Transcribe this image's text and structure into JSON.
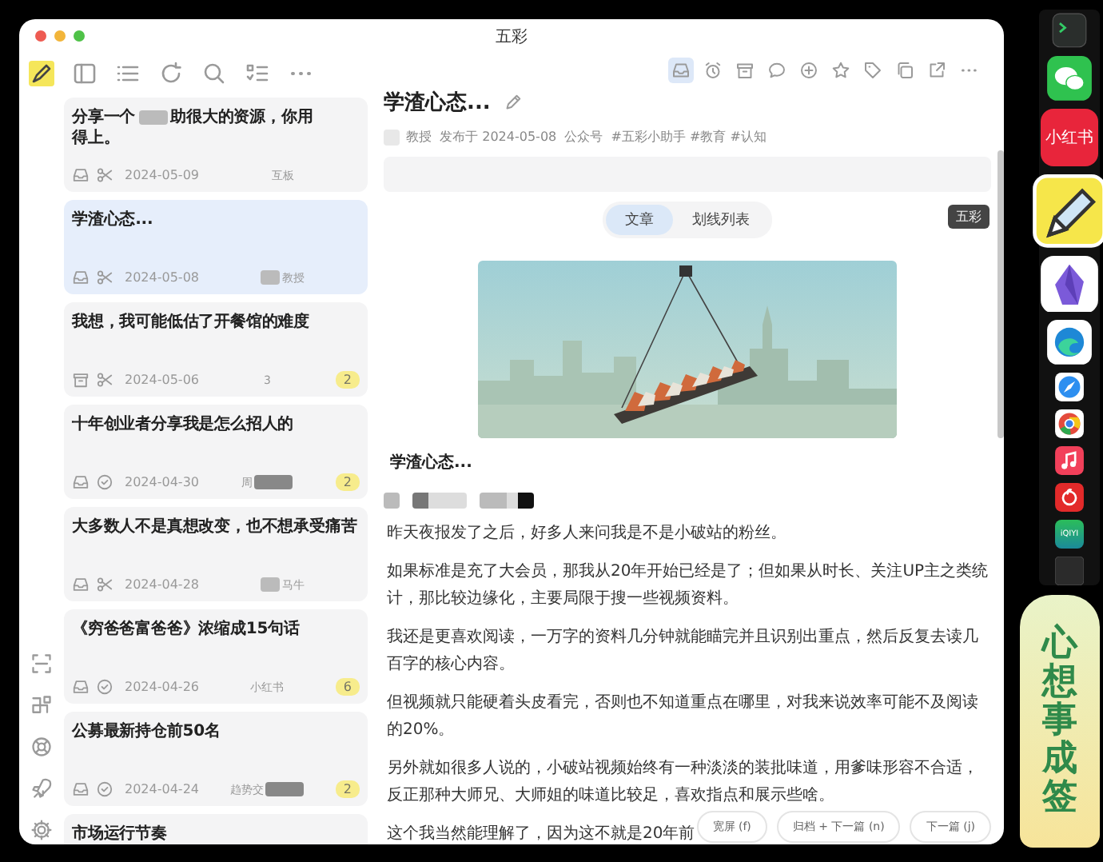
{
  "window": {
    "title": "五彩"
  },
  "left_toolbar": [
    {
      "kind": "logo"
    },
    {
      "kind": "sidebar"
    },
    {
      "kind": "list"
    },
    {
      "kind": "refresh"
    },
    {
      "kind": "search"
    },
    {
      "kind": "checklist"
    },
    {
      "kind": "more"
    }
  ],
  "cards": [
    {
      "title_parts": [
        {
          "kind": "text",
          "text": "分享一个"
        },
        {
          "kind": "redaction"
        },
        {
          "kind": "text",
          "text": "助很大的资源，你用"
        },
        {
          "kind": "text",
          "text": "得上。"
        }
      ],
      "icons": [
        {
          "kind": "inbox"
        },
        {
          "kind": "scissors"
        }
      ],
      "date": "2024-05-09",
      "source_parts": [
        {
          "kind": "text",
          "text": "互板"
        }
      ],
      "selected": false
    },
    {
      "title_parts": [
        {
          "kind": "text",
          "text": "学渣心态..."
        }
      ],
      "icons": [
        {
          "kind": "inbox"
        },
        {
          "kind": "scissors"
        }
      ],
      "date": "2024-05-08",
      "source_parts": [
        {
          "kind": "redaction"
        },
        {
          "kind": "text",
          "text": "教授"
        }
      ],
      "selected": true
    },
    {
      "title_parts": [
        {
          "kind": "text",
          "text": "我想，我可能低估了开餐馆的难度"
        }
      ],
      "icons": [
        {
          "kind": "archive"
        },
        {
          "kind": "scissors"
        }
      ],
      "date": "2024-05-06",
      "source_parts": [
        {
          "kind": "text",
          "text": "3"
        }
      ],
      "badge": "2",
      "selected": false
    },
    {
      "title_parts": [
        {
          "kind": "text",
          "text": "十年创业者分享我是怎么招人的"
        }
      ],
      "icons": [
        {
          "kind": "inbox"
        },
        {
          "kind": "circle"
        }
      ],
      "date": "2024-04-30",
      "source_parts": [
        {
          "kind": "text",
          "text": "周"
        },
        {
          "kind": "redaction"
        }
      ],
      "badge": "2",
      "selected": false
    },
    {
      "title_parts": [
        {
          "kind": "text",
          "text": "大多数人不是真想改变，也不想承受痛苦"
        }
      ],
      "icons": [
        {
          "kind": "inbox"
        },
        {
          "kind": "scissors"
        }
      ],
      "date": "2024-04-28",
      "source_parts": [
        {
          "kind": "redaction"
        },
        {
          "kind": "text",
          "text": "马牛"
        }
      ],
      "selected": false
    },
    {
      "title_parts": [
        {
          "kind": "text",
          "text": "《穷爸爸富爸爸》浓缩成15句话"
        }
      ],
      "icons": [
        {
          "kind": "inbox"
        },
        {
          "kind": "circle"
        }
      ],
      "date": "2024-04-26",
      "source_parts": [
        {
          "kind": "text",
          "text": "小红书"
        }
      ],
      "badge": "6",
      "selected": false
    },
    {
      "title_parts": [
        {
          "kind": "text",
          "text": "公募最新持仓前50名"
        }
      ],
      "icons": [
        {
          "kind": "inbox"
        },
        {
          "kind": "circle"
        }
      ],
      "date": "2024-04-24",
      "source_parts": [
        {
          "kind": "text",
          "text": "趋势交"
        },
        {
          "kind": "redaction"
        }
      ],
      "badge": "2",
      "selected": false
    },
    {
      "title_parts": [
        {
          "kind": "text",
          "text": "市场运行节奏"
        }
      ],
      "selected": false
    }
  ],
  "rail": [
    {
      "kind": "scan"
    },
    {
      "kind": "apps"
    },
    {
      "kind": "lifebuoy"
    },
    {
      "kind": "rocket"
    },
    {
      "kind": "gear"
    }
  ],
  "content_toolbar": [
    {
      "kind": "inbox",
      "selected": true
    },
    {
      "kind": "alarm",
      "selected": false
    },
    {
      "kind": "archive",
      "selected": false
    },
    {
      "kind": "comment",
      "selected": false
    },
    {
      "kind": "plus",
      "selected": false
    },
    {
      "kind": "star",
      "selected": false
    },
    {
      "kind": "tag",
      "selected": false
    },
    {
      "kind": "copy",
      "selected": false
    },
    {
      "kind": "external",
      "selected": false
    },
    {
      "kind": "more",
      "selected": false
    }
  ],
  "article": {
    "title": "学渣心态...",
    "meta": "教授  发布于 2024-05-08  公众号  #五彩小助手 #教育 #认知",
    "tabs": [
      {
        "label": "文章",
        "selected": true
      },
      {
        "label": "划线列表",
        "selected": false
      }
    ],
    "heading": "学渣心态...",
    "paragraphs": [
      "昨天夜报发了之后，好多人来问我是不是小破站的粉丝。",
      "如果标准是充了大会员，那我从20年开始已经是了；但如果从时长、关注UP主之类统计，那比较边缘化，主要局限于搜一些视频资料。",
      "我还是更喜欢阅读，一万字的资料几分钟就能瞄完并且识别出重点，然后反复去读几百字的核心内容。",
      "但视频就只能硬着头皮看完，否则也不知道重点在哪里，对我来说效率可能不及阅读的20%。",
      "另外就如很多人说的，小破站视频始终有一种淡淡的装批味道，用爹味形容不合适，反正那种大师兄、大师姐的味道比较足，喜欢指点和展示些啥。",
      "这个我当然能理解了，因为这不就是20年前"
    ],
    "buttons": [
      "宽屏 (f)",
      "归档 + 下一篇 (n)",
      "下一篇 (j)"
    ]
  },
  "dock_tooltip": "五彩",
  "dock": [
    {
      "kind": "terminal"
    },
    {
      "kind": "chat"
    },
    {
      "kind": "redbook",
      "label": "小红书"
    },
    {
      "kind": "pen"
    },
    {
      "kind": "gem"
    },
    {
      "kind": "wave"
    },
    {
      "kind": "compass"
    },
    {
      "kind": "chrome"
    },
    {
      "kind": "music"
    },
    {
      "kind": "netease"
    },
    {
      "kind": "video",
      "label": "iQIYI"
    },
    {
      "kind": "dark"
    }
  ],
  "sticker": {
    "text": "心想事成签"
  }
}
